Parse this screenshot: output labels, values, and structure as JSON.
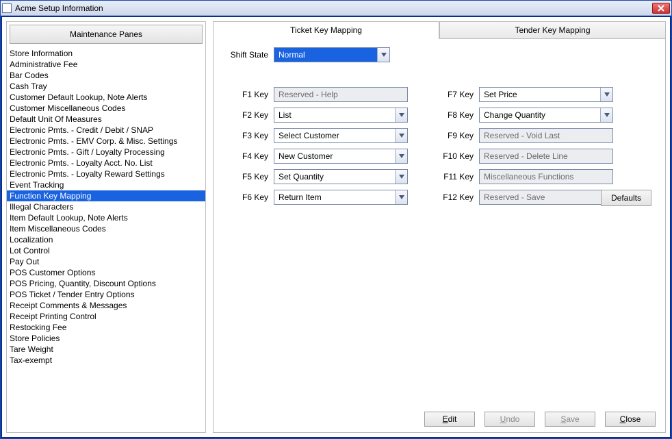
{
  "window": {
    "title": "Acme Setup Information"
  },
  "sidebar": {
    "header": "Maintenance Panes",
    "items": [
      "Store Information",
      "Administrative Fee",
      "Bar Codes",
      "Cash Tray",
      "Customer Default Lookup, Note Alerts",
      "Customer Miscellaneous Codes",
      "Default Unit Of Measures",
      "Electronic Pmts. - Credit / Debit / SNAP",
      "Electronic Pmts. - EMV Corp. & Misc. Settings",
      "Electronic Pmts. - Gift / Loyalty Processing",
      "Electronic Pmts. - Loyalty Acct. No. List",
      "Electronic Pmts. - Loyalty Reward Settings",
      "Event Tracking",
      "Function Key Mapping",
      "Illegal Characters",
      "Item Default Lookup, Note Alerts",
      "Item Miscellaneous Codes",
      "Localization",
      "Lot Control",
      "Pay Out",
      "POS Customer Options",
      "POS Pricing, Quantity, Discount Options",
      "POS Ticket / Tender Entry Options",
      "Receipt Comments & Messages",
      "Receipt Printing Control",
      "Restocking Fee",
      "Store Policies",
      "Tare  Weight",
      "Tax-exempt"
    ],
    "selected_index": 13
  },
  "tabs": {
    "items": [
      "Ticket Key Mapping",
      "Tender Key Mapping"
    ],
    "active_index": 0
  },
  "form": {
    "shift_state": {
      "label": "Shift State",
      "value": "Normal"
    },
    "left_keys": [
      {
        "label": "F1 Key",
        "value": "Reserved - Help",
        "readonly": true
      },
      {
        "label": "F2 Key",
        "value": "List",
        "readonly": false
      },
      {
        "label": "F3 Key",
        "value": "Select Customer",
        "readonly": false
      },
      {
        "label": "F4 Key",
        "value": "New Customer",
        "readonly": false
      },
      {
        "label": "F5 Key",
        "value": "Set Quantity",
        "readonly": false
      },
      {
        "label": "F6 Key",
        "value": "Return Item",
        "readonly": false
      }
    ],
    "right_keys": [
      {
        "label": "F7 Key",
        "value": "Set Price",
        "readonly": false
      },
      {
        "label": "F8 Key",
        "value": "Change Quantity",
        "readonly": false
      },
      {
        "label": "F9 Key",
        "value": "Reserved - Void Last",
        "readonly": true
      },
      {
        "label": "F10 Key",
        "value": "Reserved - Delete Line",
        "readonly": true
      },
      {
        "label": "F11 Key",
        "value": "Miscellaneous Functions",
        "readonly": true
      },
      {
        "label": "F12 Key",
        "value": "Reserved - Save",
        "readonly": true
      }
    ],
    "defaults_button": "Defaults"
  },
  "buttons": {
    "edit": "Edit",
    "undo": "Undo",
    "save": "Save",
    "close": "Close"
  }
}
